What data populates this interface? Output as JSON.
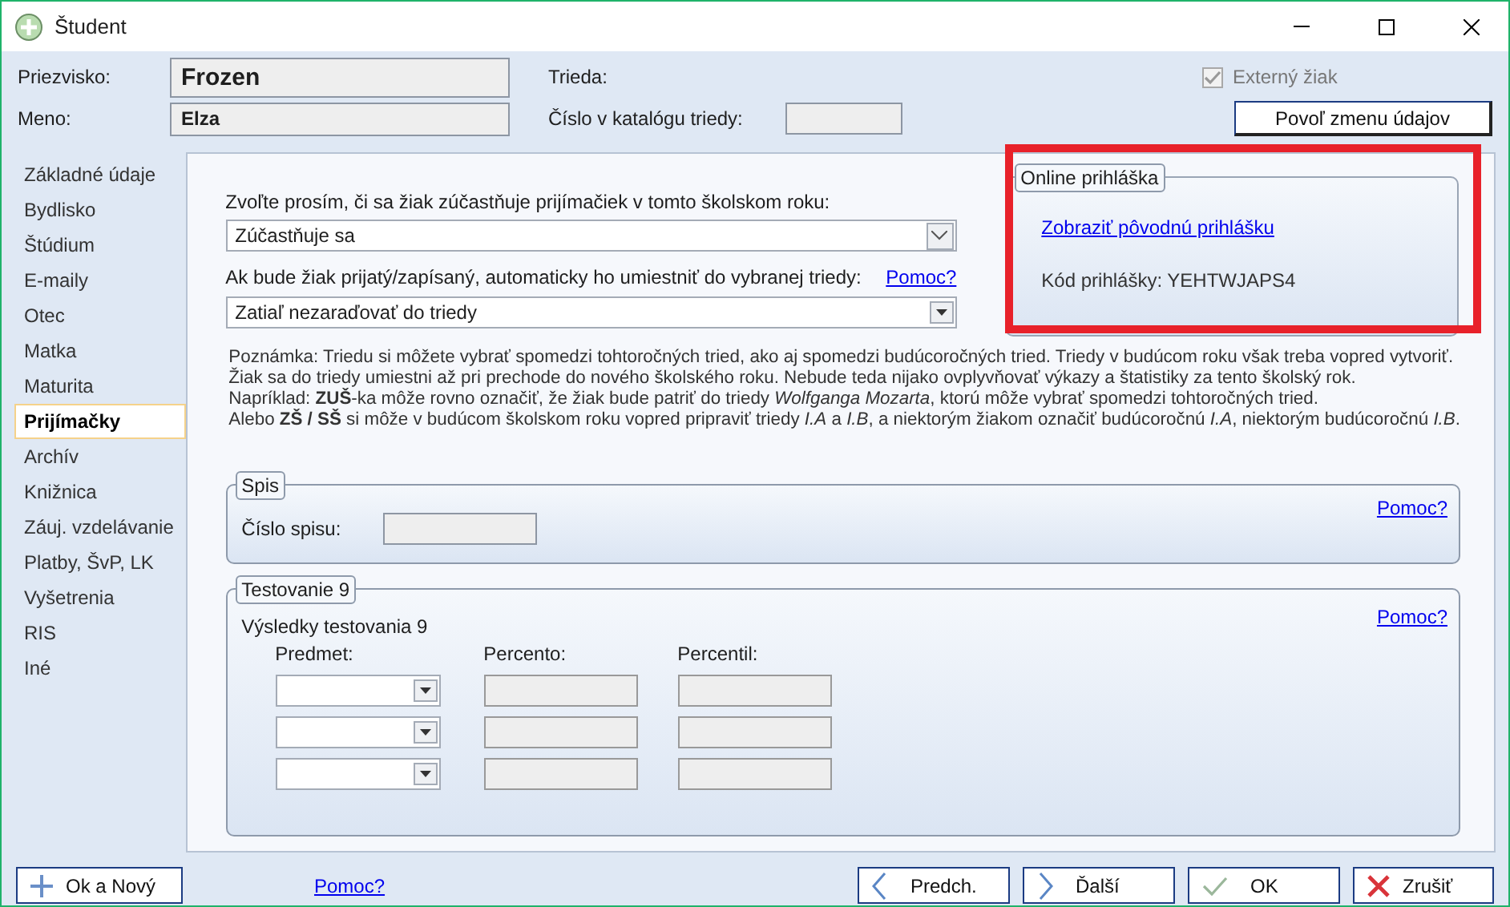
{
  "window": {
    "title": "Študent"
  },
  "header": {
    "surname_label": "Priezvisko:",
    "surname": "Frozen",
    "name_label": "Meno:",
    "name": "Elza",
    "class_label": "Trieda:",
    "catalog_label": "Číslo v katalógu triedy:",
    "external": {
      "label": "Externý žiak",
      "checked": true,
      "disabled": true
    },
    "allow_button": "Povoľ zmenu údajov"
  },
  "sidebar": {
    "items": [
      {
        "label": "Základné údaje",
        "selected": false
      },
      {
        "label": "Bydlisko",
        "selected": false
      },
      {
        "label": "Štúdium",
        "selected": false
      },
      {
        "label": "E-maily",
        "selected": false
      },
      {
        "label": "Otec",
        "selected": false
      },
      {
        "label": "Matka",
        "selected": false
      },
      {
        "label": "Maturita",
        "selected": false
      },
      {
        "label": "Prijímačky",
        "selected": true
      },
      {
        "label": "Archív",
        "selected": false
      },
      {
        "label": "Knižnica",
        "selected": false
      },
      {
        "label": "Záuj. vzdelávanie",
        "selected": false
      },
      {
        "label": "Platby, ŠvP, LK",
        "selected": false
      },
      {
        "label": "Vyšetrenia",
        "selected": false
      },
      {
        "label": "RIS",
        "selected": false
      },
      {
        "label": "Iné",
        "selected": false
      }
    ]
  },
  "admission": {
    "participate_label": "Zvoľte prosím, či sa žiak zúčastňuje prijímačiek v tomto školskom roku:",
    "participate_value": "Zúčastňuje sa",
    "class_label": "Ak bude žiak prijatý/zapísaný, automaticky ho umiestniť do vybranej triedy:",
    "help": "Pomoc?",
    "class_value": "Zatiaľ nezaraďovať do triedy",
    "note": [
      "Poznámka: Triedu si môžete vybrať spomedzi tohtoročných tried, ako aj spomedzi budúcoročných tried. Triedy v budúcom roku však treba vopred vytvoriť.",
      "Žiak sa do triedy umiestni až pri prechode do nového školského roku. Nebude teda nijako ovplyvňovať výkazy a štatistiky za tento školský rok.",
      "Napríklad: **ZUŠ**-ka môže rovno označiť, že žiak bude patriť do triedy *Wolfganga Mozarta*, ktorú môže vybrať spomedzi tohtoročných tried.",
      "Alebo **ZŠ / SŠ** si môže v budúcom školskom roku vopred pripraviť triedy *I.A* a *I.B*, a niektorým žiakom označiť budúcoročnú *I.A*, niektorým budúcoročnú *I.B*."
    ]
  },
  "online": {
    "title": "Online prihláška",
    "link": "Zobraziť pôvodnú prihlášku",
    "code": "Kód prihlášky: YEHTWJAPS4",
    "highlighted": true
  },
  "spis": {
    "title": "Spis",
    "label": "Číslo spisu:",
    "help": "Pomoc?"
  },
  "testing": {
    "title": "Testovanie 9",
    "subtitle": "Výsledky testovania 9",
    "help": "Pomoc?",
    "columns": [
      "Predmet:",
      "Percento:",
      "Percentil:"
    ]
  },
  "footer": {
    "ok_new": "Ok a Nový",
    "help": "Pomoc?",
    "prev": "Predch.",
    "next": "Ďalší",
    "ok": "OK",
    "cancel": "Zrušiť"
  }
}
